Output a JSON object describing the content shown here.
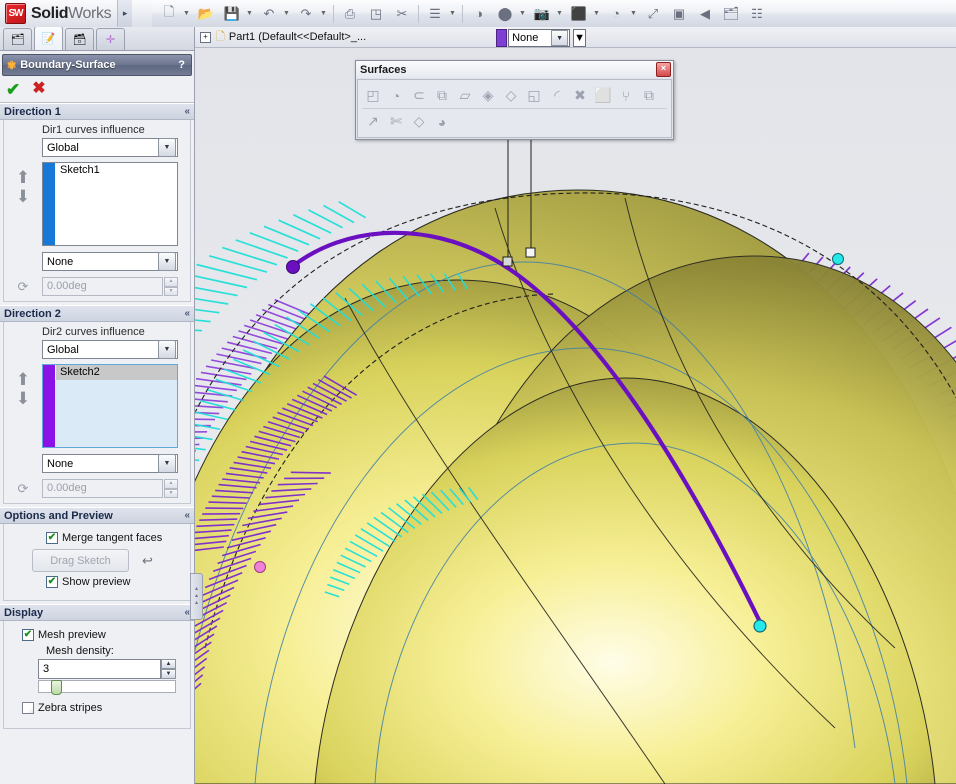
{
  "app": {
    "brand_bold": "Solid",
    "brand_light": "Works",
    "logo_text": "SW",
    "menu_arrow": "▸"
  },
  "toolbar": {
    "buttons": [
      {
        "name": "new-document",
        "icon": "🗋",
        "caret": true
      },
      {
        "name": "open-document",
        "icon": "📂",
        "caret": false
      },
      {
        "name": "save-document",
        "icon": "💾",
        "caret": true
      },
      {
        "name": "undo",
        "icon": "↶",
        "caret": true
      },
      {
        "name": "redo",
        "icon": "↷",
        "caret": true
      },
      {
        "name": "print",
        "icon": "⎙",
        "caret": false
      },
      {
        "name": "measure",
        "icon": "◳",
        "caret": false
      },
      {
        "name": "section-view",
        "icon": "✂",
        "caret": false
      },
      {
        "name": "rebuild",
        "icon": "☰",
        "caret": true
      },
      {
        "name": "display-style",
        "icon": "◑",
        "caret": false
      },
      {
        "name": "view-orientation",
        "icon": "⬤",
        "caret": true
      },
      {
        "name": "view-settings",
        "icon": "📷",
        "caret": true
      },
      {
        "name": "appearance",
        "icon": "⬛",
        "caret": true
      },
      {
        "name": "scene",
        "icon": "◔",
        "caret": true
      },
      {
        "name": "full-screen",
        "icon": "⤢",
        "caret": false
      },
      {
        "name": "window-tile",
        "icon": "▣",
        "caret": false
      },
      {
        "name": "play-back",
        "icon": "◀",
        "caret": false
      },
      {
        "name": "notes",
        "icon": "🗂",
        "caret": false
      },
      {
        "name": "options",
        "icon": "☷",
        "caret": false
      }
    ]
  },
  "property_manager": {
    "tabs": [
      {
        "name": "feature-manager-tab",
        "icon": "📐",
        "active": false
      },
      {
        "name": "property-manager-tab",
        "icon": "📝",
        "active": true
      },
      {
        "name": "configuration-manager-tab",
        "icon": "🗂",
        "active": false
      },
      {
        "name": "display-manager-tab",
        "icon": "⊕",
        "active": false
      }
    ],
    "title": "Boundary-Surface",
    "title_icon": "❈",
    "help": "?",
    "ok": "✔",
    "cancel": "✖"
  },
  "direction1": {
    "header": "Direction 1",
    "chevron": "«",
    "influence_label": "Dir1 curves influence",
    "influence_value": "Global",
    "curves": [
      {
        "label": "Sketch1",
        "highlighted": false
      }
    ],
    "color": "#1878d8",
    "tangent_type": "None",
    "angle": "0.00deg",
    "up_arrow": "⬆",
    "down_arrow": "⬇",
    "reverse_icon": "⟳"
  },
  "direction2": {
    "header": "Direction 2",
    "chevron": "«",
    "influence_label": "Dir2 curves influence",
    "influence_value": "Global",
    "curves": [
      {
        "label": "Sketch2",
        "highlighted": true
      }
    ],
    "color": "#8b13e8",
    "tangent_type": "None",
    "angle": "0.00deg",
    "up_arrow": "⬆",
    "down_arrow": "⬇",
    "reverse_icon": "⟳"
  },
  "options_preview": {
    "header": "Options and Preview",
    "chevron": "«",
    "merge_tangent_faces": {
      "label": "Merge tangent faces",
      "checked": true
    },
    "drag_sketch_button": "Drag Sketch",
    "undo_icon": "↩",
    "show_preview": {
      "label": "Show preview",
      "checked": true
    }
  },
  "display": {
    "header": "Display",
    "chevron": "«",
    "mesh_preview": {
      "label": "Mesh preview",
      "checked": true
    },
    "mesh_density_label": "Mesh density:",
    "mesh_density_value": "3",
    "zebra_stripes": {
      "label": "Zebra stripes",
      "checked": false
    }
  },
  "splitter": {
    "name": "panel-splitter",
    "glyph": "▴"
  },
  "feature_bar": {
    "expand": "+",
    "part_icon": "📃",
    "part_text": "Part1  (Default<<Default>_...",
    "config_swatch_color": "#7d3fd6",
    "config_value": "None",
    "caret": "▾"
  },
  "surfaces_toolbar": {
    "title": "Surfaces",
    "close": "×",
    "row1": [
      {
        "name": "extruded-surface-icon",
        "glyph": "◰"
      },
      {
        "name": "revolved-surface-icon",
        "glyph": "◔"
      },
      {
        "name": "swept-surface-icon",
        "glyph": "⊂"
      },
      {
        "name": "lofted-surface-icon",
        "glyph": "⧉"
      },
      {
        "name": "boundary-surface-icon",
        "glyph": "▱"
      },
      {
        "name": "filled-surface-icon",
        "glyph": "◈"
      },
      {
        "name": "freeform-icon",
        "glyph": "◇"
      },
      {
        "name": "planar-surface-icon",
        "glyph": "◱"
      },
      {
        "name": "offset-surface-icon",
        "glyph": "◜"
      },
      {
        "name": "delete-face-icon",
        "glyph": "✖"
      },
      {
        "name": "knit-surface-icon",
        "glyph": "⬜"
      },
      {
        "name": "ruled-surface-icon",
        "glyph": "⑂"
      },
      {
        "name": "thicken-icon",
        "glyph": "⧉"
      }
    ],
    "row2": [
      {
        "name": "extend-surface-icon",
        "glyph": "↗"
      },
      {
        "name": "trim-surface-icon",
        "glyph": "✄"
      },
      {
        "name": "untrim-surface-icon",
        "glyph": "◇"
      },
      {
        "name": "replace-face-icon",
        "glyph": "◕"
      }
    ]
  },
  "viewport": {
    "name": "3d-graphics-area",
    "background_top": "#e3e5ea",
    "background_bottom": "#eceef1",
    "surface_light": "#fdfbc8",
    "surface_mid": "#ece46a",
    "surface_dark": "#9a9440",
    "comb_cyan": "#1fe8e0",
    "comb_purple": "#7d29d4",
    "guide_curve": "#6a10c0",
    "point_magenta": "#f080d8",
    "point_cyan": "#25e8e8",
    "point_purple": "#6a10c0"
  }
}
